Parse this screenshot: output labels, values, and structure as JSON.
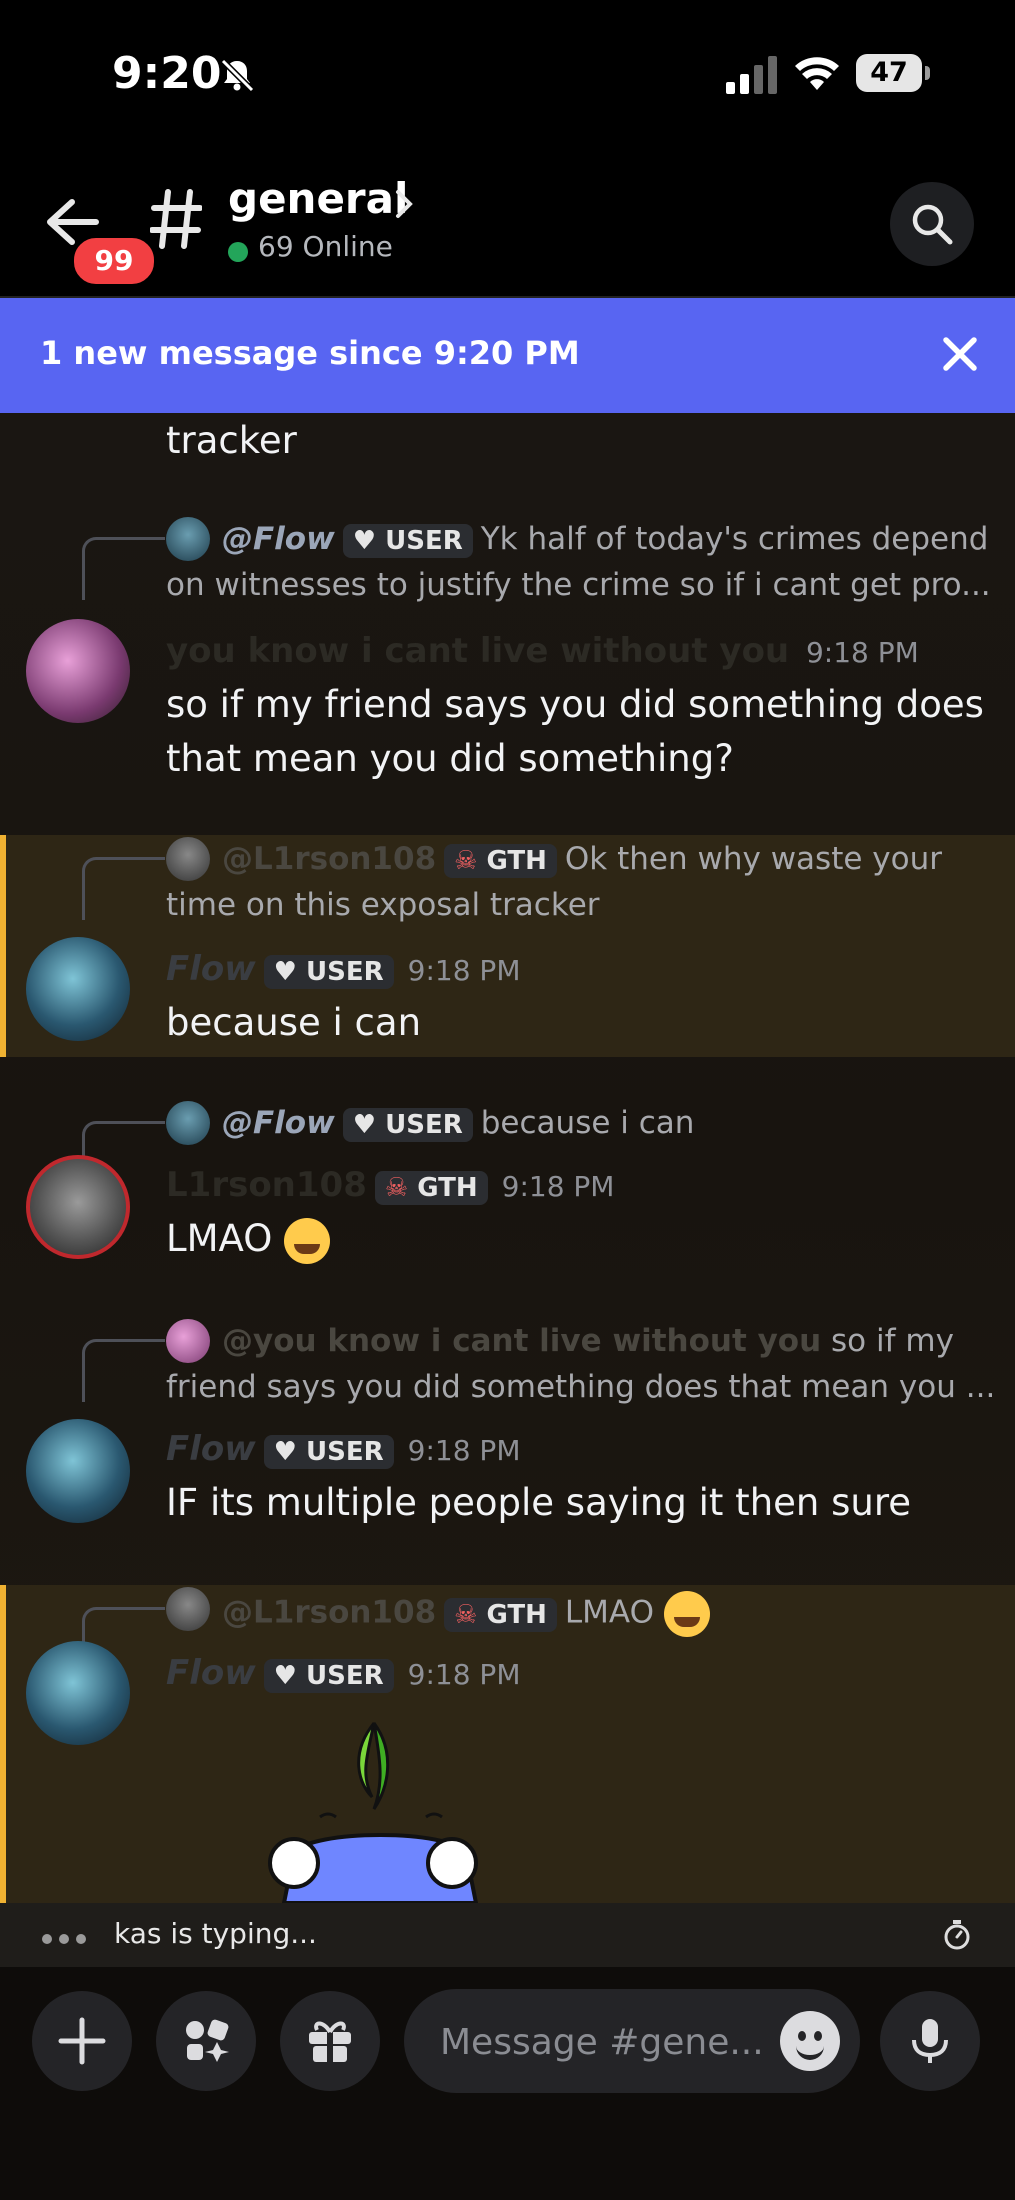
{
  "status_bar": {
    "time": "9:20",
    "battery": "47"
  },
  "header": {
    "unread_badge": "99",
    "channel": "general",
    "online": "69 Online"
  },
  "banner": {
    "text": "1 new message since 9:20 PM"
  },
  "messages": [
    {
      "text": "tracker"
    },
    {
      "reply_to": {
        "name": "@Flow",
        "tag": "USER",
        "line1": "Yk half of today's crimes depend",
        "line2": "on witnesses to justify the crime so if i cant get pro..."
      },
      "author": "you know i cant live without you",
      "time": "9:18 PM",
      "line1": "so if my friend says you did something does",
      "line2": "that mean you did something?"
    },
    {
      "reply_to": {
        "name": "@L1rson108",
        "tag": "GTH",
        "line1": "Ok then why waste your",
        "line2": "time on this exposal tracker"
      },
      "author": "Flow",
      "tag": "USER",
      "time": "9:18 PM",
      "text": "because i can"
    },
    {
      "reply_to": {
        "name": "@Flow",
        "tag": "USER",
        "line1": "because i can"
      },
      "author": "L1rson108",
      "tag": "GTH",
      "time": "9:18 PM",
      "text": "LMAO"
    },
    {
      "reply_to": {
        "name": "@you know i cant live without you",
        "line1": "so if my",
        "line2": "friend says you did something does that mean you ..."
      },
      "author": "Flow",
      "tag": "USER",
      "time": "9:18 PM",
      "text": "IF its multiple people saying it then sure"
    },
    {
      "reply_to": {
        "name": "@L1rson108",
        "tag": "GTH",
        "line1": "LMAO"
      },
      "author": "Flow",
      "tag": "USER",
      "time": "9:18 PM"
    }
  ],
  "typing": {
    "text": "kas is typing..."
  },
  "composer": {
    "placeholder": "Message #gene..."
  },
  "colors": {
    "accent": "#5865f2",
    "highlight_bar": "#f0b232",
    "online": "#23a55a",
    "badge": "#f23f42"
  }
}
